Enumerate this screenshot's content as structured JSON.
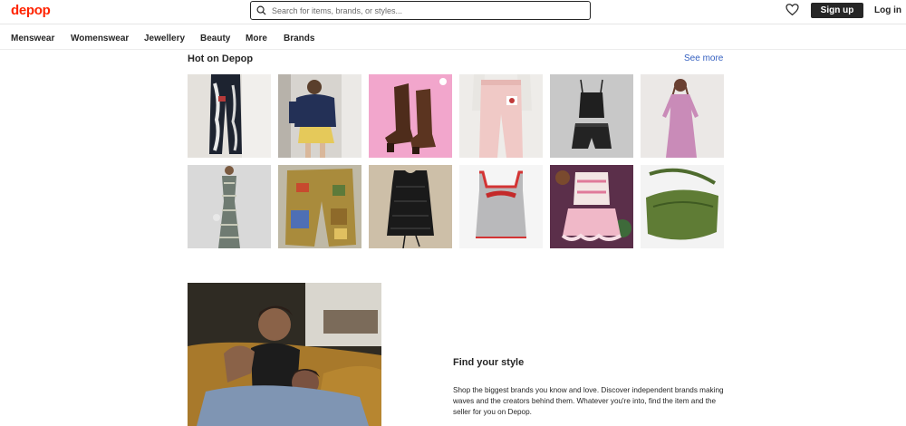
{
  "header": {
    "logo": "depop",
    "search_placeholder": "Search for items, brands, or styles...",
    "signup_label": "Sign up",
    "login_label": "Log in"
  },
  "nav": {
    "items": [
      {
        "label": "Menswear"
      },
      {
        "label": "Womenswear"
      },
      {
        "label": "Jewellery"
      },
      {
        "label": "Beauty"
      },
      {
        "label": "More"
      },
      {
        "label": "Brands"
      }
    ]
  },
  "hot": {
    "title": "Hot on Depop",
    "see_more": "See more",
    "products": [
      {
        "icon": "graphic-jeans-photo",
        "bg": "#e4e1dc"
      },
      {
        "icon": "navy-sweater-skirt-photo",
        "bg": "#d7d4cf"
      },
      {
        "icon": "brown-leather-boots-photo",
        "bg": "#f2a6cc"
      },
      {
        "icon": "pink-joggers-photo",
        "bg": "#eeece9"
      },
      {
        "icon": "black-top-shorts-set-photo",
        "bg": "#c8c8c8"
      },
      {
        "icon": "pink-mesh-dress-photo",
        "bg": "#ebe8e6"
      },
      {
        "icon": "patterned-maxi-dress-photo",
        "bg": "#d9d9d9"
      },
      {
        "icon": "patchwork-cargo-pants-photo",
        "bg": "#bfb9a6"
      },
      {
        "icon": "black-mesh-top-photo",
        "bg": "#cdbfa8"
      },
      {
        "icon": "cherry-grey-tank-photo",
        "bg": "#f5f5f5"
      },
      {
        "icon": "pink-ruffle-set-photo",
        "bg": "#5b2f4a"
      },
      {
        "icon": "green-crossbody-bag-photo",
        "bg": "#f3f3f3"
      }
    ]
  },
  "feature": {
    "image": "couple-on-sofa-photo",
    "title": "Find your style",
    "body": "Shop the biggest brands you know and love. Discover independent brands making waves and the creators behind them. Whatever you're into, find the item and the seller for you on Depop."
  }
}
